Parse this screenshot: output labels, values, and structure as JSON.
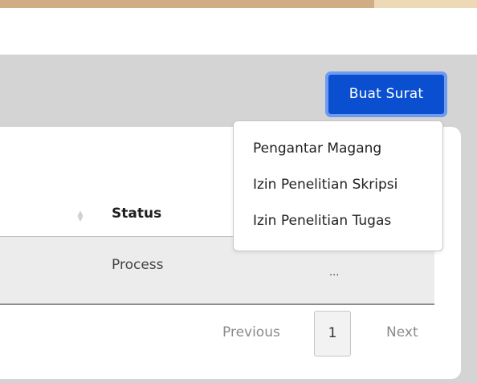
{
  "header": {
    "create_button_label": "Buat Surat"
  },
  "dropdown": {
    "items": [
      {
        "label": "Pengantar Magang"
      },
      {
        "label": "Izin Penelitian Skripsi"
      },
      {
        "label": "Izin Penelitian Tugas"
      }
    ]
  },
  "table": {
    "columns": [
      {
        "label": "Status"
      }
    ],
    "rows": [
      {
        "status": "Process",
        "action": "..."
      }
    ]
  },
  "pagination": {
    "previous_label": "Previous",
    "current_page": "1",
    "next_label": "Next"
  },
  "icons": {
    "sort": "sort-arrows-icon"
  },
  "colors": {
    "primary_button": "#0b4fd1",
    "top_accent": "#d1ad85",
    "section_background": "#d4d4d4"
  }
}
